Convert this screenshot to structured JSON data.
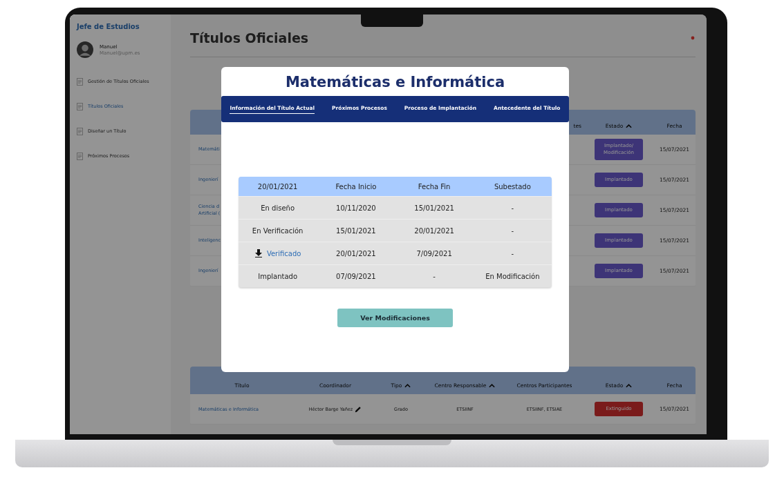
{
  "sidebar": {
    "role": "Jefe de Estudios",
    "user": {
      "name": "Manuel",
      "email": "Manuel@upm.es"
    },
    "items": [
      {
        "label": "Gestión de Títulos Oficiales",
        "selected": false
      },
      {
        "label": "Títulos Oficiales",
        "selected": true
      },
      {
        "label": "Diseñar un Título",
        "selected": false
      },
      {
        "label": "Próximos Procesos",
        "selected": false
      }
    ]
  },
  "page_title": "Títulos Oficiales",
  "top_table": {
    "headers": [
      {
        "label": "tes",
        "sortable": false
      },
      {
        "label": "Estado",
        "sortable": true
      },
      {
        "label": "Fecha",
        "sortable": false
      }
    ],
    "rows": [
      {
        "title": "Matemáti",
        "status": "Implantado/\nModificación",
        "kind": "implanted",
        "date": "15/07/2021"
      },
      {
        "title": "Ingenierí",
        "status": "Implantado",
        "kind": "implanted",
        "date": "15/07/2021"
      },
      {
        "title": "Ciencia d\nArtificial (",
        "status": "Implantado",
        "kind": "implanted",
        "date": "15/07/2021"
      },
      {
        "title": "Inteligenc",
        "status": "Implantado",
        "kind": "implanted",
        "date": "15/07/2021"
      },
      {
        "title": "Ingenierí",
        "status": "Implantado",
        "kind": "implanted",
        "date": "15/07/2021"
      }
    ]
  },
  "bottom_table": {
    "headers": [
      {
        "label": "Título",
        "sortable": false
      },
      {
        "label": "Coordinador",
        "sortable": false
      },
      {
        "label": "Tipo",
        "sortable": true
      },
      {
        "label": "Centro Responsable",
        "sortable": true
      },
      {
        "label": "Centros Participantes",
        "sortable": false
      },
      {
        "label": "Estado",
        "sortable": true
      },
      {
        "label": "Fecha",
        "sortable": false
      }
    ],
    "rows": [
      {
        "title": "Matemáticas e Informática",
        "coordinator": "Héctor Barge Yañez",
        "type": "Grado",
        "center": "ETSIINF",
        "participants": "ETSIINF, ETSIAE",
        "status": "Extinguido",
        "kind": "extinct",
        "date": "15/07/2021"
      }
    ]
  },
  "modal": {
    "title": "Matemáticas e Informática",
    "tabs": [
      {
        "label": "Información del Título Actual",
        "selected": true
      },
      {
        "label": "Próximos Procesos",
        "selected": false
      },
      {
        "label": "Proceso de Implantación",
        "selected": false
      },
      {
        "label": "Antecedente del Título",
        "selected": false
      }
    ],
    "table": {
      "headers": [
        "20/01/2021",
        "Fecha Inicio",
        "Fecha Fin",
        "Subestado"
      ],
      "rows": [
        {
          "kind": "plain",
          "cells": [
            "En diseño",
            "10/11/2020",
            "15/01/2021",
            "-"
          ]
        },
        {
          "kind": "plain",
          "cells": [
            "En Verificación",
            "15/01/2021",
            "20/01/2021",
            "-"
          ]
        },
        {
          "kind": "download",
          "cells": [
            "Verificado",
            "20/01/2021",
            "7/09/2021",
            "-"
          ]
        },
        {
          "kind": "plain",
          "cells": [
            "Implantado",
            "07/09/2021",
            "-",
            "En Modificación"
          ]
        }
      ]
    },
    "button": "Ver Modificaciones"
  }
}
